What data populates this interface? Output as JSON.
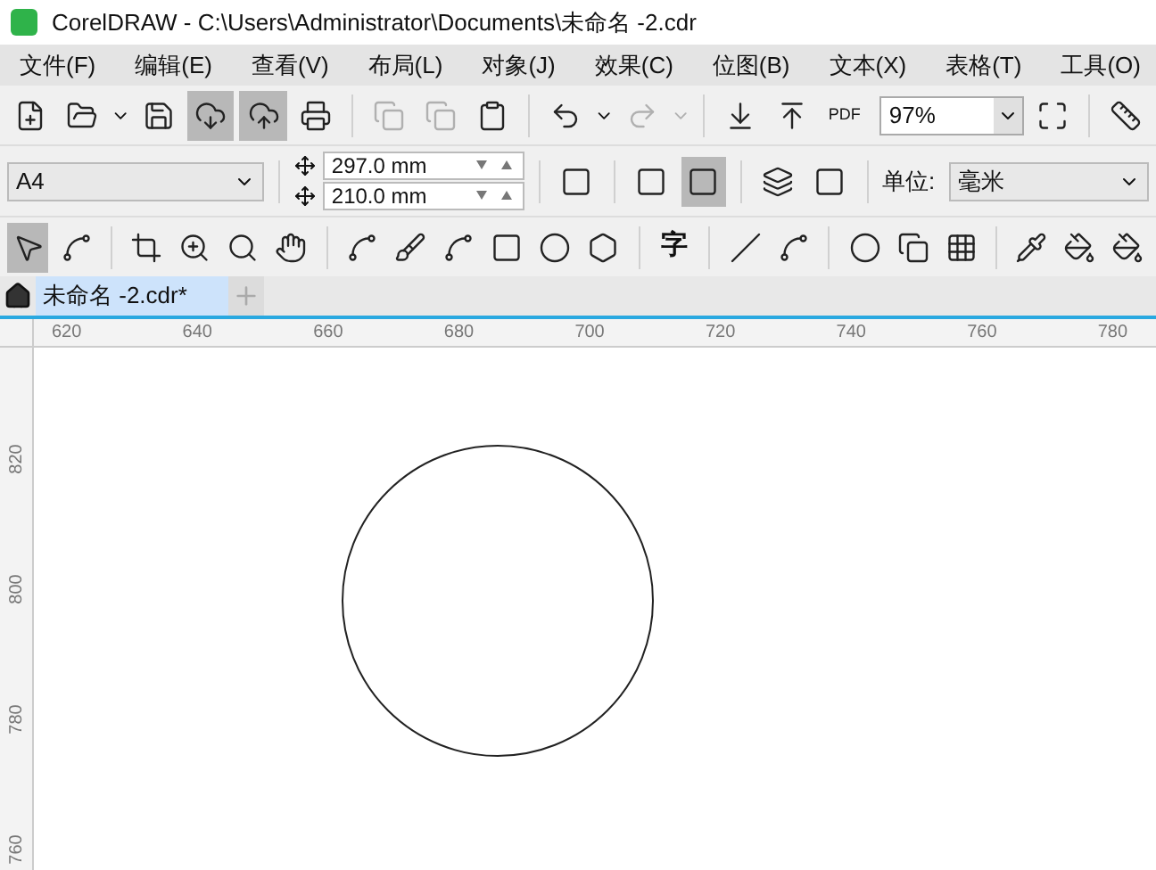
{
  "window": {
    "title": "CorelDRAW - C:\\Users\\Administrator\\Documents\\未命名 -2.cdr"
  },
  "menu": [
    "文件(F)",
    "编辑(E)",
    "查看(V)",
    "布局(L)",
    "对象(J)",
    "效果(C)",
    "位图(B)",
    "文本(X)",
    "表格(T)",
    "工具(O)"
  ],
  "standard_toolbar": {
    "pdf_label": "PDF",
    "zoom": "97%"
  },
  "property_bar": {
    "page_size": "A4",
    "width": "297.0 mm",
    "height": "210.0 mm",
    "units_label": "单位:",
    "units": "毫米"
  },
  "toolbox": {
    "text_tool_label": "字"
  },
  "tabs": [
    {
      "label": "未命名 -2.cdr*",
      "selected": true
    }
  ],
  "rulers": {
    "horizontal": [
      "620",
      "640",
      "660",
      "680",
      "700",
      "720",
      "740",
      "760",
      "780"
    ],
    "vertical": [
      "820",
      "800",
      "780",
      "760"
    ]
  }
}
